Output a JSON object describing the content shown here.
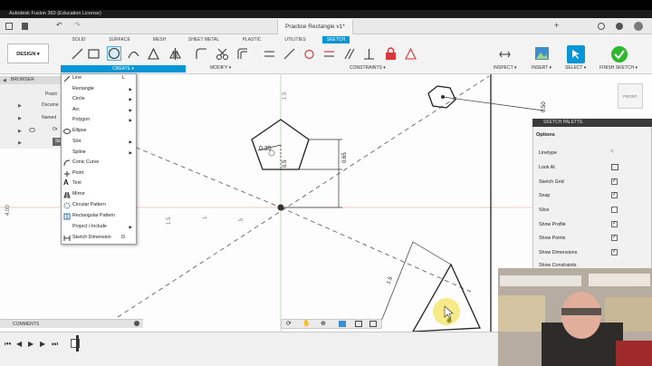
{
  "app": {
    "title": "Autodesk Fusion 360 (Education License)",
    "document_tab": "Practice Rectangle v1*"
  },
  "workspace": {
    "label": "DESIGN ▾",
    "tabs": [
      "SOLID",
      "SURFACE",
      "MESH",
      "SHEET METAL",
      "PLASTIC",
      "UTILITIES",
      "SKETCH"
    ],
    "active_tab": "SKETCH"
  },
  "toolbar": {
    "create": "CREATE ▾",
    "modify": "MODIFY ▾",
    "constraints": "CONSTRAINTS ▾",
    "inspect": "INSPECT ▾",
    "insert": "INSERT ▾",
    "select": "SELECT ▾",
    "finish": "FINISH SKETCH ▾"
  },
  "browser": {
    "title": "BROWSER",
    "items": [
      "Practi",
      "Docume",
      "Named",
      "Or",
      "Sk"
    ]
  },
  "create_menu": [
    {
      "label": "Line",
      "shortcut": "L",
      "arrow": false
    },
    {
      "label": "Rectangle",
      "shortcut": "",
      "arrow": true
    },
    {
      "label": "Circle",
      "shortcut": "",
      "arrow": true
    },
    {
      "label": "Arc",
      "shortcut": "",
      "arrow": true
    },
    {
      "label": "Polygon",
      "shortcut": "",
      "arrow": true
    },
    {
      "label": "Ellipse",
      "shortcut": "",
      "arrow": false
    },
    {
      "label": "Slot",
      "shortcut": "",
      "arrow": true
    },
    {
      "label": "Spline",
      "shortcut": "",
      "arrow": true
    },
    {
      "label": "Conic Curve",
      "shortcut": "",
      "arrow": false
    },
    {
      "label": "Point",
      "shortcut": "",
      "arrow": false
    },
    {
      "label": "Text",
      "shortcut": "",
      "arrow": false
    },
    {
      "label": "Mirror",
      "shortcut": "",
      "arrow": false
    },
    {
      "label": "Circular Pattern",
      "shortcut": "",
      "arrow": false
    },
    {
      "label": "Rectangular Pattern",
      "shortcut": "",
      "arrow": false
    },
    {
      "label": "Project / Include",
      "shortcut": "",
      "arrow": true
    },
    {
      "label": "Sketch Dimension",
      "shortcut": "D",
      "arrow": false
    }
  ],
  "palette": {
    "title": "SKETCH PALETTE",
    "options_label": "Options",
    "options": [
      {
        "label": "Linetype",
        "checked": null
      },
      {
        "label": "Look At",
        "checked": null
      },
      {
        "label": "Sketch Grid",
        "checked": true
      },
      {
        "label": "Snap",
        "checked": true
      },
      {
        "label": "Slice",
        "checked": false
      },
      {
        "label": "Show Profile",
        "checked": true
      },
      {
        "label": "Show Points",
        "checked": true
      },
      {
        "label": "Show Dimensions",
        "checked": true
      },
      {
        "label": "Show Constraints",
        "checked": true
      }
    ]
  },
  "viewcube": {
    "label": "FRONT"
  },
  "comments": {
    "label": "COMMENTS"
  },
  "dimensions": [
    "0.35",
    "0.5",
    "0.65",
    "1.5",
    "0.50",
    "4.00",
    "1.5",
    "1",
    ".5",
    "1.5"
  ],
  "colors": {
    "accent": "#0696d7",
    "finish": "#2eb82e",
    "stop": "#d9363e"
  }
}
